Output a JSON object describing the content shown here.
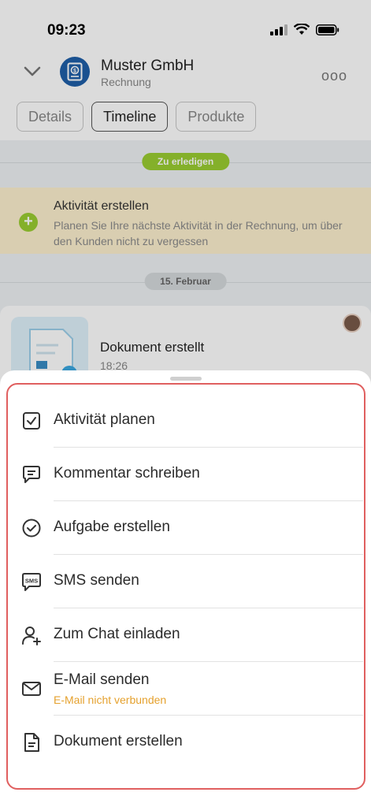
{
  "status_bar": {
    "time": "09:23"
  },
  "header": {
    "title": "Muster GmbH",
    "subtitle": "Rechnung",
    "more_label": "ooo"
  },
  "tabs": [
    {
      "label": "Details",
      "active": false
    },
    {
      "label": "Timeline",
      "active": true
    },
    {
      "label": "Produkte",
      "active": false
    }
  ],
  "timeline": {
    "todo_badge": "Zu erledigen",
    "activity": {
      "title": "Aktivität erstellen",
      "description": "Planen Sie Ihre nächste Aktivität in der Rechnung, um über den Kunden nicht zu vergessen"
    },
    "date_badge": "15. Februar",
    "event": {
      "title": "Dokument erstellt",
      "time": "18:26"
    }
  },
  "menu": {
    "items": [
      {
        "label": "Aktivität planen",
        "icon": "calendar-check-icon"
      },
      {
        "label": "Kommentar schreiben",
        "icon": "comment-icon"
      },
      {
        "label": "Aufgabe erstellen",
        "icon": "task-check-icon"
      },
      {
        "label": "SMS senden",
        "icon": "sms-icon"
      },
      {
        "label": "Zum Chat einladen",
        "icon": "add-user-icon"
      },
      {
        "label": "E-Mail senden",
        "icon": "mail-icon",
        "sublabel": "E-Mail nicht verbunden"
      },
      {
        "label": "Dokument erstellen",
        "icon": "document-icon"
      }
    ]
  },
  "colors": {
    "accent_green": "#9acd32",
    "highlight_border": "#e05f5f",
    "warning_text": "#e5a12e",
    "activity_bg": "#fdf0cf"
  }
}
